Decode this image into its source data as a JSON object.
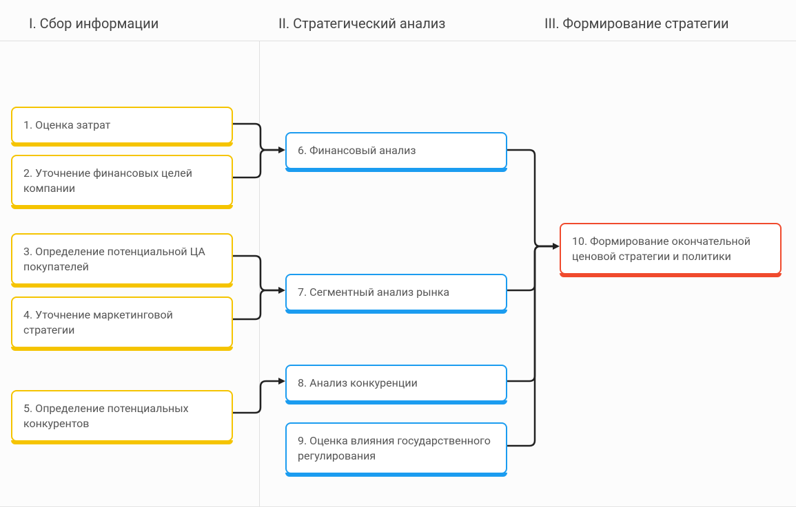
{
  "columns": {
    "c1": "I.  Сбор информации",
    "c2": "II.  Стратегический анализ",
    "c3": "III. Формирование стратегии"
  },
  "boxes": {
    "b1": "1. Оценка затрат",
    "b2": "2. Уточнение финансовых целей компании",
    "b3": "3. Определение потенциальной ЦА покупателей",
    "b4": "4. Уточнение маркетинговой стратегии",
    "b5": "5. Определение потенциальных конкурентов",
    "b6": "6. Финансовый анализ",
    "b7": "7. Сегментный анализ рынка",
    "b8": "8. Анализ конкуренции",
    "b9": "9. Оценка влияния государственного регулирования",
    "b10": "10. Формирование окончательной ценовой стратегии и политики"
  },
  "colors": {
    "yellow": "#f5c400",
    "blue": "#1b9cf0",
    "red": "#f04a2d"
  }
}
